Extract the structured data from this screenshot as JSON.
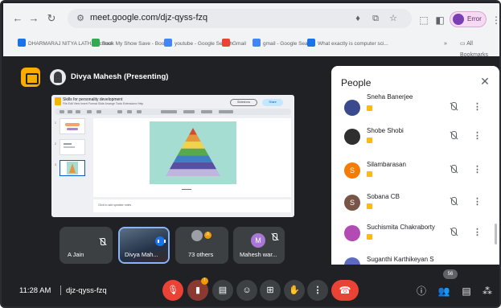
{
  "browser": {
    "url": "meet.google.com/djz-qyss-fzq",
    "profile_label": "Error",
    "bookmarks": [
      {
        "label": "DHARMARAJ NITYA LATHA School",
        "color": "#1a73e8"
      },
      {
        "label": "Book My Show Save - Book...",
        "color": "#34a853"
      },
      {
        "label": "youtube - Google Search",
        "color": "#4285f4"
      },
      {
        "label": "Gmail",
        "color": "#ea4335"
      },
      {
        "label": "gmail - Google Search",
        "color": "#4285f4"
      },
      {
        "label": "What exactly is computer sci...",
        "color": "#1a73e8"
      }
    ],
    "all_bookmarks": "All Bookmarks"
  },
  "meet": {
    "presenter": "Divya Mahesh (Presenting)",
    "meeting_code": "djz-qyss-fzq",
    "time": "11:28 AM",
    "participant_count": "56",
    "raised_hands_indicator": "1"
  },
  "shared_slide": {
    "doc_title": "Skills for personality development",
    "menu": "File  Edit  View  Insert  Format  Slide  Arrange  Tools  Extensions  Help",
    "slideshow_label": "Slideshow",
    "share_label": "Share",
    "notes_placeholder": "Click to add speaker notes",
    "thumb_numbers": [
      "1",
      "2",
      "3"
    ],
    "pyramid_colors": [
      "#d84a2f",
      "#e7953a",
      "#f0d24b",
      "#5aa84c",
      "#3d7fc1",
      "#5a4ea3",
      "#bfb6dd"
    ],
    "pyramid_bg": "#a6ddd2"
  },
  "tiles": [
    {
      "name": "A Jain",
      "muted": true
    },
    {
      "name": "Divya Mah...",
      "speaking": true
    },
    {
      "name": "73 others",
      "badge": "A"
    },
    {
      "name": "Mahesh war...",
      "avatar": "M",
      "muted": true
    }
  ],
  "people_panel": {
    "title": "People",
    "participants": [
      {
        "name": "Sneha Banerjee",
        "avatar_color": "#3b4a8c"
      },
      {
        "name": "Shobe Shobi",
        "avatar_color": "#2f2f2f"
      },
      {
        "name": "Silambarasan",
        "avatar_color": "#f57c00"
      },
      {
        "name": "Sobana CB",
        "avatar_color": "#795548"
      },
      {
        "name": "Suchismita Chakraborty",
        "avatar_color": "#b24bb3"
      },
      {
        "name": "Suganthi Karthikeyan S",
        "avatar_color": "#5c6bc0"
      }
    ]
  },
  "icons": {
    "mic": "mic-off-icon",
    "camera": "camera-off-icon",
    "captions": "captions-icon",
    "emoji": "emoji-icon",
    "present": "present-icon",
    "hand": "raise-hand-icon",
    "more": "more-vert-icon",
    "end": "end-call-icon",
    "info": "info-icon",
    "people": "people-icon",
    "chat": "chat-icon",
    "activities": "activities-icon"
  }
}
